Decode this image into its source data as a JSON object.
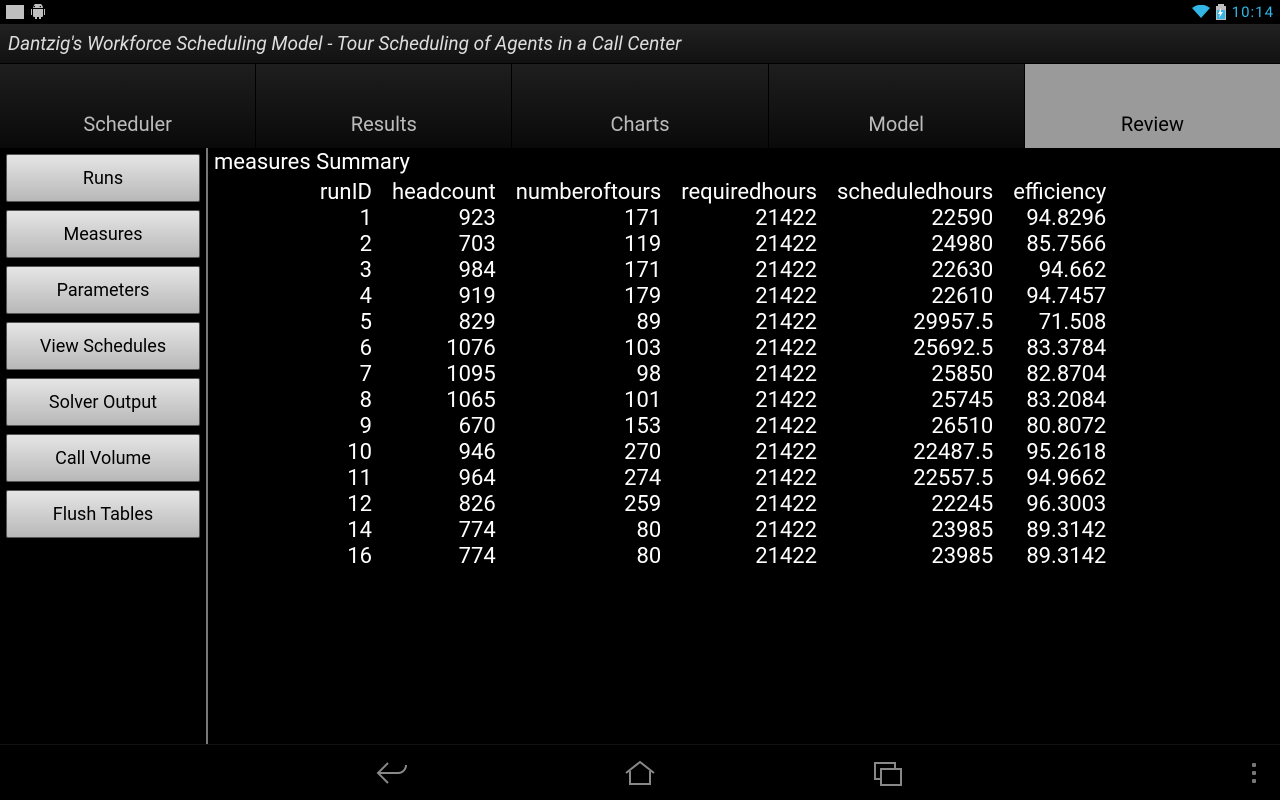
{
  "status": {
    "time": "10:14"
  },
  "app": {
    "title": "Dantzig's Workforce Scheduling Model - Tour Scheduling of Agents in a Call Center"
  },
  "tabs": [
    {
      "label": "Scheduler",
      "active": false
    },
    {
      "label": "Results",
      "active": false
    },
    {
      "label": "Charts",
      "active": false
    },
    {
      "label": "Model",
      "active": false
    },
    {
      "label": "Review",
      "active": true
    }
  ],
  "sidebar": {
    "buttons": [
      "Runs",
      "Measures",
      "Parameters",
      "View Schedules",
      "Solver Output",
      "Call Volume",
      "Flush Tables"
    ]
  },
  "summary": {
    "title": "measures Summary",
    "columns": [
      "runID",
      "headcount",
      "numberoftours",
      "requiredhours",
      "scheduledhours",
      "efficiency"
    ]
  },
  "chart_data": {
    "type": "table",
    "columns": [
      "runID",
      "headcount",
      "numberoftours",
      "requiredhours",
      "scheduledhours",
      "efficiency"
    ],
    "rows": [
      [
        1,
        923,
        171,
        21422,
        22590,
        94.8296
      ],
      [
        2,
        703,
        119,
        21422,
        24980,
        85.7566
      ],
      [
        3,
        984,
        171,
        21422,
        22630,
        94.662
      ],
      [
        4,
        919,
        179,
        21422,
        22610,
        94.7457
      ],
      [
        5,
        829,
        89,
        21422,
        29957.5,
        71.508
      ],
      [
        6,
        1076,
        103,
        21422,
        25692.5,
        83.3784
      ],
      [
        7,
        1095,
        98,
        21422,
        25850,
        82.8704
      ],
      [
        8,
        1065,
        101,
        21422,
        25745,
        83.2084
      ],
      [
        9,
        670,
        153,
        21422,
        26510,
        80.8072
      ],
      [
        10,
        946,
        270,
        21422,
        22487.5,
        95.2618
      ],
      [
        11,
        964,
        274,
        21422,
        22557.5,
        94.9662
      ],
      [
        12,
        826,
        259,
        21422,
        22245,
        96.3003
      ],
      [
        14,
        774,
        80,
        21422,
        23985,
        89.3142
      ],
      [
        16,
        774,
        80,
        21422,
        23985,
        89.3142
      ]
    ]
  }
}
